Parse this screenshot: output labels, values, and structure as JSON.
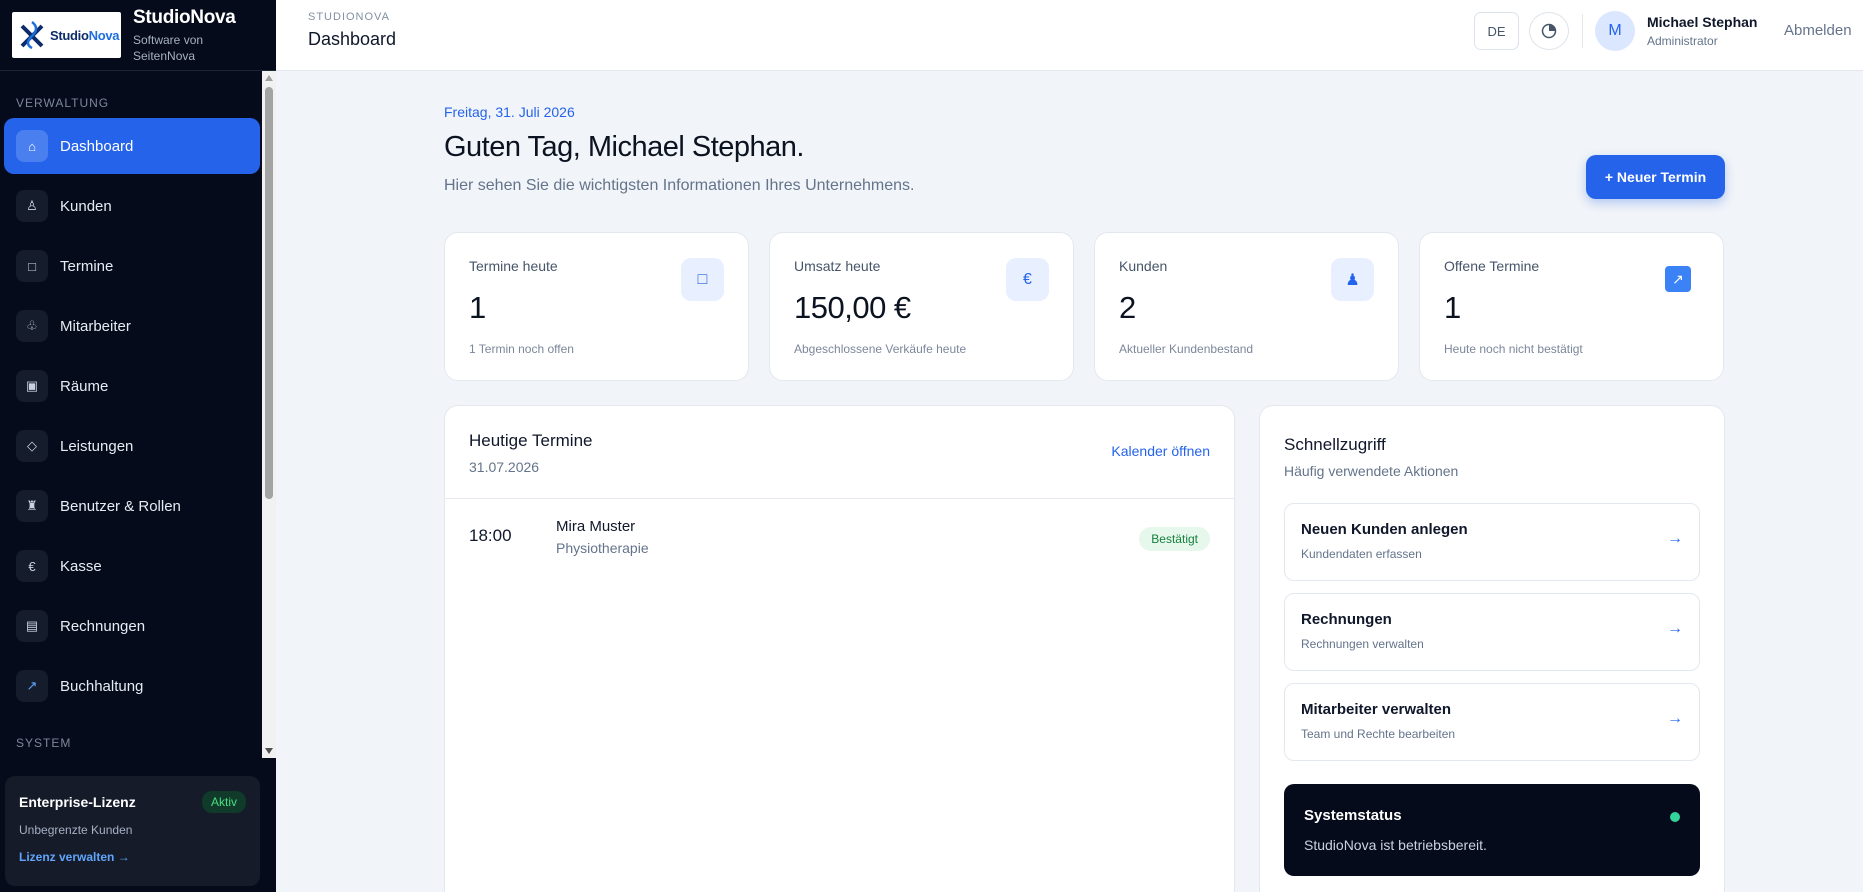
{
  "brand": {
    "logo_text_main": "Studio",
    "logo_text_accent": "Nova",
    "title": "StudioNova",
    "subtitle": "Software von SeitenNova"
  },
  "sidebar": {
    "section_admin": "VERWALTUNG",
    "section_system": "SYSTEM",
    "items": [
      {
        "label": "Dashboard",
        "icon": "home-icon",
        "active": true
      },
      {
        "label": "Kunden",
        "icon": "person-icon"
      },
      {
        "label": "Termine",
        "icon": "calendar-icon"
      },
      {
        "label": "Mitarbeiter",
        "icon": "team-icon"
      },
      {
        "label": "Räume",
        "icon": "room-icon"
      },
      {
        "label": "Leistungen",
        "icon": "diamond-icon"
      },
      {
        "label": "Benutzer & Rollen",
        "icon": "roles-icon"
      },
      {
        "label": "Kasse",
        "icon": "euro-icon"
      },
      {
        "label": "Rechnungen",
        "icon": "invoice-icon"
      },
      {
        "label": "Buchhaltung",
        "icon": "chart-arrow-icon"
      }
    ]
  },
  "license": {
    "title": "Enterprise-Lizenz",
    "badge": "Aktiv",
    "subtitle": "Unbegrenzte Kunden",
    "link": "Lizenz verwalten →"
  },
  "topbar": {
    "breadcrumb": "STUDIONOVA",
    "page_title": "Dashboard",
    "language": "DE",
    "avatar_initial": "M",
    "user_name": "Michael Stephan",
    "user_role": "Administrator",
    "logout": "Abmelden"
  },
  "header": {
    "date": "Freitag, 31. Juli 2026",
    "greeting": "Guten Tag, Michael Stephan.",
    "intro": "Hier sehen Sie die wichtigsten Informationen Ihres Unternehmens.",
    "new_button": "+ Neuer Termin"
  },
  "stats": [
    {
      "label": "Termine heute",
      "value": "1",
      "note": "1 Termin noch offen",
      "icon": "□"
    },
    {
      "label": "Umsatz heute",
      "value": "150,00 €",
      "note": "Abgeschlossene Verkäufe heute",
      "icon": "€"
    },
    {
      "label": "Kunden",
      "value": "2",
      "note": "Aktueller Kundenbestand",
      "icon": "♟"
    },
    {
      "label": "Offene Termine",
      "value": "1",
      "note": "Heute noch nicht bestätigt",
      "icon": "↗"
    }
  ],
  "appointments": {
    "title": "Heutige Termine",
    "date": "31.07.2026",
    "calendar_link": "Kalender öffnen",
    "rows": [
      {
        "time": "18:00",
        "name": "Mira Muster",
        "service": "Physiotherapie",
        "status": "Bestätigt"
      }
    ]
  },
  "quick": {
    "title": "Schnellzugriff",
    "subtitle": "Häufig verwendete Aktionen",
    "items": [
      {
        "title": "Neuen Kunden anlegen",
        "subtitle": "Kundendaten erfassen"
      },
      {
        "title": "Rechnungen",
        "subtitle": "Rechnungen verwalten"
      },
      {
        "title": "Mitarbeiter verwalten",
        "subtitle": "Team und Rechte bearbeiten"
      }
    ],
    "arrow": "→"
  },
  "system": {
    "title": "Systemstatus",
    "text": "StudioNova ist betriebsbereit."
  },
  "colors": {
    "accent": "#2563eb",
    "sidebar_bg": "#050b1a",
    "status_ok": "#34d399"
  }
}
